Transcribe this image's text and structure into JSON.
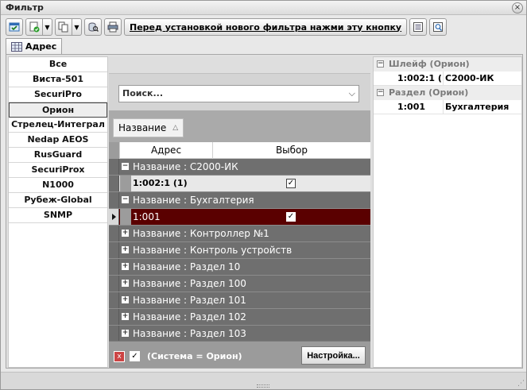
{
  "window": {
    "title": "Фильтр",
    "close_glyph": "×"
  },
  "toolbar": {
    "buttons": [
      {
        "name": "apply-filter",
        "icon": "window-check-icon"
      },
      {
        "name": "add-condition",
        "icon": "add-document-icon"
      },
      {
        "name": "copy",
        "icon": "copy-icon"
      },
      {
        "name": "search-db",
        "icon": "search-database-icon"
      },
      {
        "name": "print",
        "icon": "printer-icon"
      }
    ],
    "dropdown_glyph": "▼",
    "install_label": "Перед установкой нового фильтра нажми эту кнопку"
  },
  "tab": {
    "label": "Адрес"
  },
  "systems": [
    "Все",
    "Виста-501",
    "SecuriPro",
    "Орион",
    "Стрелец-Интеграл",
    "Nedap AEOS",
    "RusGuard",
    "SecuriProx",
    "N1000",
    "Рубеж-Global",
    "SNMP"
  ],
  "selected_system": "Орион",
  "search": {
    "placeholder": "Поиск...",
    "chevron": "⌵"
  },
  "sort": {
    "label": "Название",
    "indicator": "△"
  },
  "grid": {
    "col_address": "Адрес",
    "col_select": "Выбор",
    "check": "✓",
    "expand_minus": "−",
    "expand_plus": "+",
    "rows": [
      {
        "kind": "group",
        "text": "Название : С2000-ИК",
        "expanded": true
      },
      {
        "kind": "data",
        "address": "1:002:1 (1)",
        "checked": true
      },
      {
        "kind": "group",
        "text": "Название : Бухгалтерия",
        "expanded": true
      },
      {
        "kind": "selected",
        "address": "1:001",
        "checked": true
      },
      {
        "kind": "group",
        "text": "Название : Контроллер №1",
        "expanded": false
      },
      {
        "kind": "group",
        "text": "Название : Контроль устройств",
        "expanded": false
      },
      {
        "kind": "group",
        "text": "Название : Раздел 10",
        "expanded": false
      },
      {
        "kind": "group",
        "text": "Название : Раздел 100",
        "expanded": false
      },
      {
        "kind": "group",
        "text": "Название : Раздел 101",
        "expanded": false
      },
      {
        "kind": "group",
        "text": "Название : Раздел 102",
        "expanded": false
      },
      {
        "kind": "group",
        "text": "Название : Раздел 103",
        "expanded": false
      }
    ]
  },
  "footer": {
    "clear_glyph": "x",
    "filter_text": "(Система = Орион)",
    "settings_label": "Настройка...",
    "check": "✓"
  },
  "summary": {
    "groups": [
      {
        "title": "Шлейф (Орион)",
        "items": [
          {
            "key": "1:002:1 (1",
            "value": "С2000-ИК"
          }
        ]
      },
      {
        "title": "Раздел (Орион)",
        "items": [
          {
            "key": "1:001",
            "value": "Бухгалтерия"
          }
        ]
      }
    ],
    "collapse_glyph": "−"
  }
}
